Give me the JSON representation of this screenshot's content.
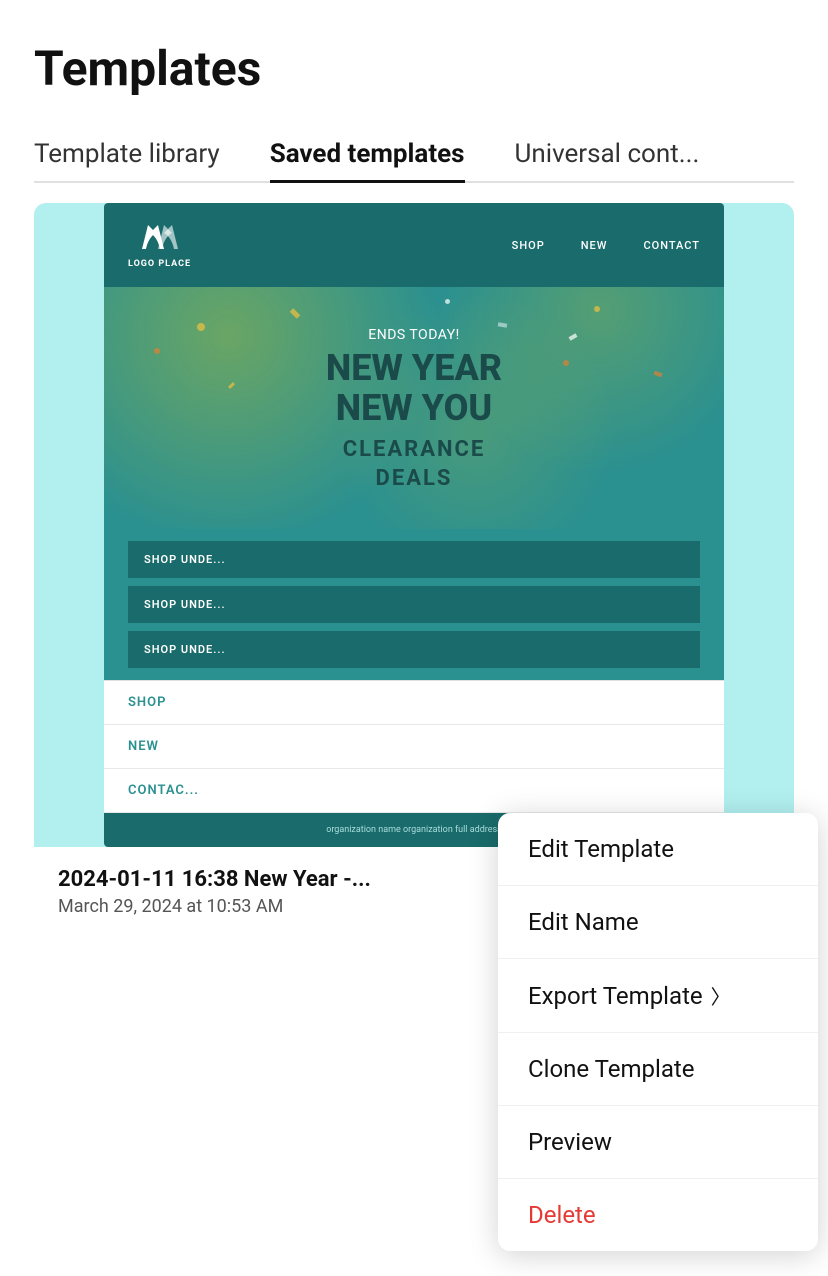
{
  "page": {
    "title": "Templates"
  },
  "tabs": [
    {
      "id": "template-library",
      "label": "Template library",
      "active": false
    },
    {
      "id": "saved-templates",
      "label": "Saved templates",
      "active": true
    },
    {
      "id": "universal-content",
      "label": "Universal cont...",
      "active": false
    }
  ],
  "template_card": {
    "email": {
      "logo_text": "LOGO PLACE",
      "nav_items": [
        "SHOP",
        "NEW",
        "CONTACT"
      ],
      "hero": {
        "ends_today": "ENDS TODAY!",
        "title_line1": "NEW YEAR",
        "title_line2": "NEW YOU",
        "subtitle_line1": "CLEARANCE",
        "subtitle_line2": "DEALS"
      },
      "shop_buttons": [
        "SHOP UNDE...",
        "SHOP UNDE...",
        "SHOP UNDE..."
      ],
      "footer_links": [
        "SHOP",
        "NEW",
        "CONTAC..."
      ],
      "address": "organization name organization full address"
    },
    "name": "2024-01-11 16:38 New Year -...",
    "date": "March 29, 2024 at 10:53 AM"
  },
  "context_menu": {
    "items": [
      {
        "id": "edit-template",
        "label": "Edit Template",
        "type": "normal"
      },
      {
        "id": "edit-name",
        "label": "Edit Name",
        "type": "normal"
      },
      {
        "id": "export-template",
        "label": "Export Template",
        "type": "normal"
      },
      {
        "id": "clone-template",
        "label": "Clone Template",
        "type": "normal"
      },
      {
        "id": "preview",
        "label": "Preview",
        "type": "normal"
      },
      {
        "id": "delete",
        "label": "Delete",
        "type": "danger"
      }
    ]
  }
}
